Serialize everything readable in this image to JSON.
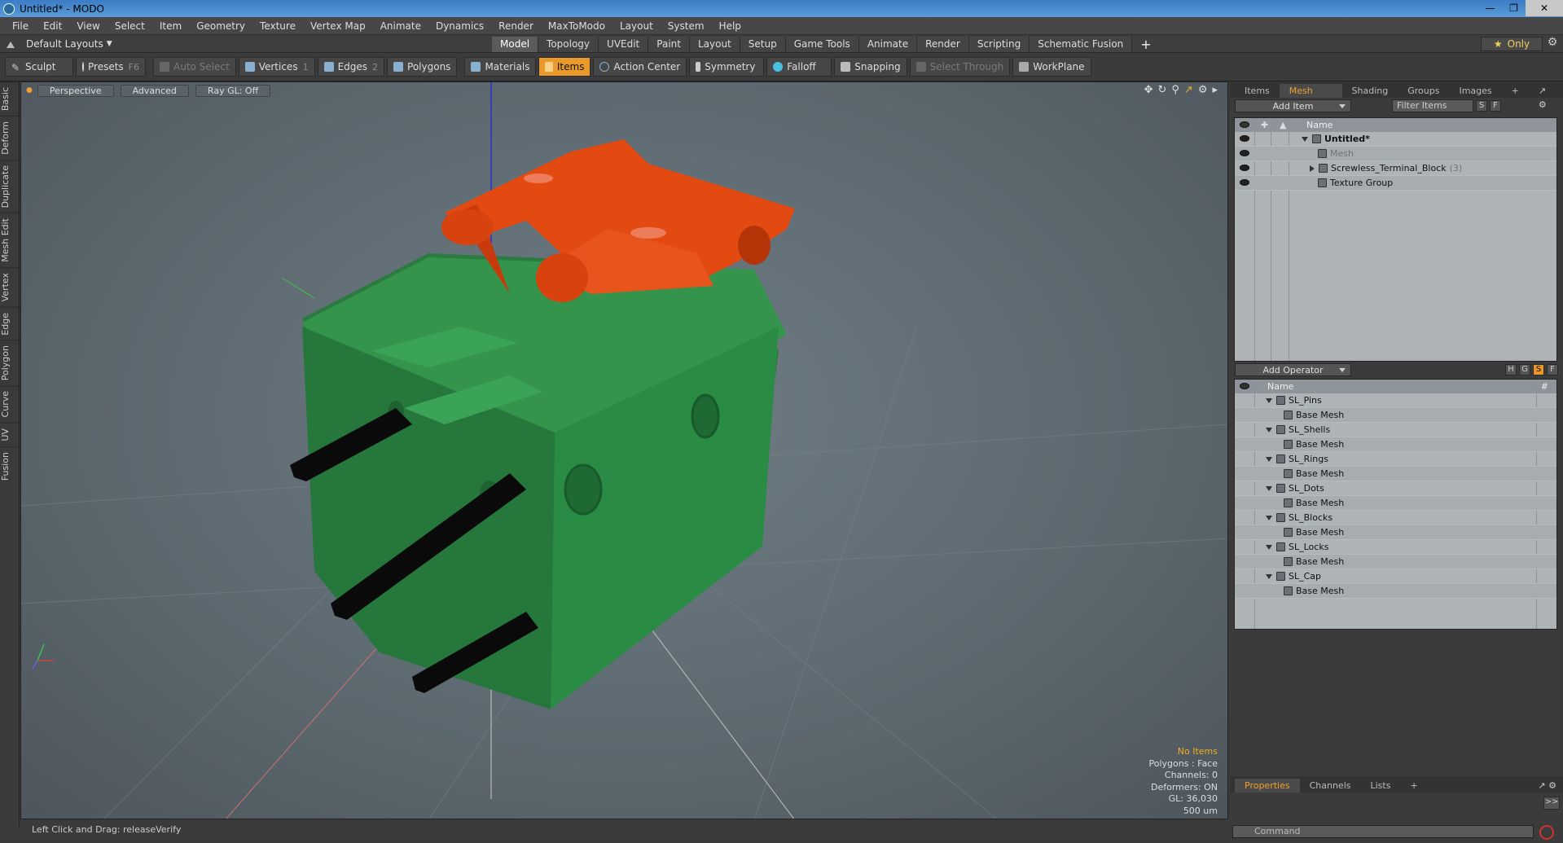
{
  "window": {
    "title": "Untitled* - MODO"
  },
  "menu": [
    "File",
    "Edit",
    "View",
    "Select",
    "Item",
    "Geometry",
    "Texture",
    "Vertex Map",
    "Animate",
    "Dynamics",
    "Render",
    "MaxToModo",
    "Layout",
    "System",
    "Help"
  ],
  "layout": {
    "name": "Default Layouts"
  },
  "tabs": [
    "Model",
    "Topology",
    "UVEdit",
    "Paint",
    "Layout",
    "Setup",
    "Game Tools",
    "Animate",
    "Render",
    "Scripting",
    "Schematic Fusion"
  ],
  "active_tab": "Model",
  "only_label": "Only",
  "toolbar": {
    "sculpt": "Sculpt",
    "presets": "Presets",
    "presets_key": "F6",
    "auto_select": "Auto Select",
    "vertices": "Vertices",
    "vertices_key": "1",
    "edges": "Edges",
    "edges_key": "2",
    "polygons": "Polygons",
    "materials": "Materials",
    "items": "Items",
    "action_center": "Action Center",
    "symmetry": "Symmetry",
    "falloff": "Falloff",
    "snapping": "Snapping",
    "select_through": "Select Through",
    "workplane": "WorkPlane"
  },
  "left_tabs": [
    "Basic",
    "Deform",
    "Duplicate",
    "Mesh Edit",
    "Vertex",
    "Edge",
    "Polygon",
    "Curve",
    "UV",
    "Fusion"
  ],
  "viewport": {
    "perspective": "Perspective",
    "advanced": "Advanced",
    "raygl": "Ray GL: Off",
    "info": {
      "no_items": "No Items",
      "polygons": "Polygons : Face",
      "channels": "Channels: 0",
      "deformers": "Deformers: ON",
      "gl": "GL: 36,030",
      "scale": "500 um"
    }
  },
  "status": {
    "text": "Left Click and Drag:  releaseVerify"
  },
  "items_panel": {
    "tabs": [
      "Items",
      "Mesh Ops",
      "Shading",
      "Groups",
      "Images"
    ],
    "active": "Mesh Ops",
    "add_item": "Add Item",
    "filter": "Filter Items",
    "s_btn": "S",
    "f_btn": "F",
    "col_name": "Name",
    "rows": [
      {
        "label": "Untitled*",
        "indent": 0,
        "expand": "down",
        "style": "bold"
      },
      {
        "label": "Mesh",
        "indent": 1,
        "expand": "",
        "style": "dim"
      },
      {
        "label": "Screwless_Terminal_Block",
        "count": "(3)",
        "indent": 1,
        "expand": "right",
        "style": ""
      },
      {
        "label": "Texture Group",
        "indent": 1,
        "expand": "",
        "style": ""
      }
    ]
  },
  "meshops_panel": {
    "add_operator": "Add Operator",
    "h_btn": "H",
    "g_btn": "G",
    "s_btn": "S",
    "f_btn": "F",
    "col_name": "Name",
    "col_hash": "#",
    "rows": [
      {
        "label": "SL_Pins",
        "child": false
      },
      {
        "label": "Base Mesh",
        "child": true
      },
      {
        "label": "SL_Shells",
        "child": false
      },
      {
        "label": "Base Mesh",
        "child": true
      },
      {
        "label": "SL_Rings",
        "child": false
      },
      {
        "label": "Base Mesh",
        "child": true
      },
      {
        "label": "SL_Dots",
        "child": false
      },
      {
        "label": "Base Mesh",
        "child": true
      },
      {
        "label": "SL_Blocks",
        "child": false
      },
      {
        "label": "Base Mesh",
        "child": true
      },
      {
        "label": "SL_Locks",
        "child": false
      },
      {
        "label": "Base Mesh",
        "child": true
      },
      {
        "label": "SL_Cap",
        "child": false
      },
      {
        "label": "Base Mesh",
        "child": true
      }
    ]
  },
  "props_panel": {
    "tabs": [
      "Properties",
      "Channels",
      "Lists"
    ],
    "active": "Properties"
  },
  "command": {
    "placeholder": "Command"
  },
  "colors": {
    "accent": "#e99a2a",
    "green_body": "#2e8a44",
    "orange_cap": "#e34a12",
    "pins": "#0a0a0a"
  }
}
